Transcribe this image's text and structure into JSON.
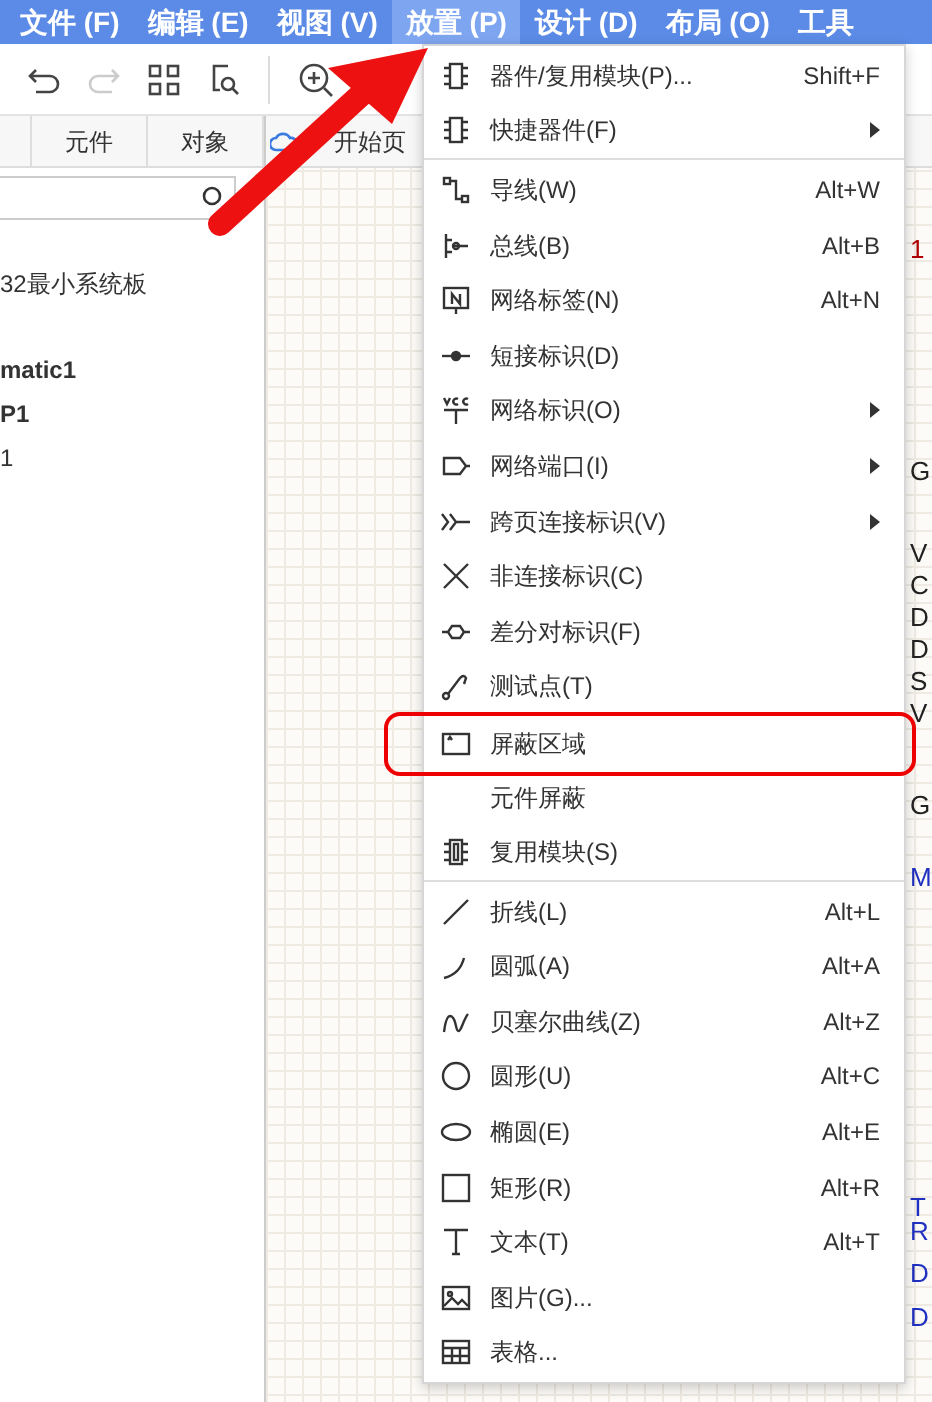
{
  "menu_bar": [
    {
      "label": "文件 (F)",
      "selected": false
    },
    {
      "label": "编辑 (E)",
      "selected": false
    },
    {
      "label": "视图 (V)",
      "selected": false
    },
    {
      "label": "放置 (P)",
      "selected": true
    },
    {
      "label": "设计 (D)",
      "selected": false
    },
    {
      "label": "布局 (O)",
      "selected": false
    },
    {
      "label": "工具",
      "selected": false
    }
  ],
  "panel_tabs": [
    {
      "label": "元件"
    },
    {
      "label": "对象"
    },
    {
      "label": "开始页"
    }
  ],
  "tree": [
    {
      "label": "32最小系统板",
      "bold": false
    },
    {
      "label": "matic1",
      "bold": true
    },
    {
      "label": "P1",
      "bold": true
    },
    {
      "label": "1",
      "bold": false
    }
  ],
  "canvas_labels": [
    {
      "text": "1",
      "color": "#b00000"
    },
    {
      "text": "G",
      "color": "#222222"
    },
    {
      "text": "V",
      "color": "#222222"
    },
    {
      "text": "C",
      "color": "#222222"
    },
    {
      "text": "D",
      "color": "#222222"
    },
    {
      "text": "D",
      "color": "#222222"
    },
    {
      "text": "S",
      "color": "#222222"
    },
    {
      "text": "V",
      "color": "#222222"
    },
    {
      "text": "G",
      "color": "#222222"
    },
    {
      "text": "M",
      "color": "#2030c0"
    },
    {
      "text": "T",
      "color": "#2030c0"
    },
    {
      "text": "R",
      "color": "#2030c0"
    },
    {
      "text": "D",
      "color": "#2030c0"
    },
    {
      "text": "D",
      "color": "#2030c0"
    }
  ],
  "place_menu": {
    "groups": [
      [
        {
          "kind": "chip",
          "label": "器件/复用模块(P)...",
          "shortcut": "Shift+F",
          "submenu": false,
          "circled": false
        },
        {
          "kind": "chip",
          "label": "快捷器件(F)",
          "submenu": true,
          "circled": false
        }
      ],
      [
        {
          "kind": "wire",
          "label": "导线(W)",
          "shortcut": "Alt+W",
          "submenu": false,
          "circled": false
        },
        {
          "kind": "bus",
          "label": "总线(B)",
          "shortcut": "Alt+B",
          "submenu": false,
          "circled": false
        },
        {
          "kind": "netlabel",
          "label": "网络标签(N)",
          "shortcut": "Alt+N",
          "submenu": false,
          "circled": false
        },
        {
          "kind": "short",
          "label": "短接标识(D)",
          "submenu": false,
          "circled": false
        },
        {
          "kind": "vcc",
          "label": "网络标识(O)",
          "submenu": true,
          "circled": false
        },
        {
          "kind": "port",
          "label": "网络端口(I)",
          "submenu": true,
          "circled": false
        },
        {
          "kind": "offpage",
          "label": "跨页连接标识(V)",
          "submenu": true,
          "circled": false
        },
        {
          "kind": "noconnect",
          "label": "非连接标识(C)",
          "submenu": false,
          "circled": false
        },
        {
          "kind": "diff",
          "label": "差分对标识(F)",
          "submenu": false,
          "circled": false
        },
        {
          "kind": "probe",
          "label": "测试点(T)",
          "submenu": false,
          "circled": false
        },
        {
          "kind": "area",
          "label": "屏蔽区域",
          "submenu": false,
          "circled": true
        },
        {
          "kind": "none",
          "label": "元件屏蔽",
          "submenu": false,
          "circled": false
        },
        {
          "kind": "module",
          "label": "复用模块(S)",
          "submenu": false,
          "circled": false
        }
      ],
      [
        {
          "kind": "line",
          "label": "折线(L)",
          "shortcut": "Alt+L",
          "submenu": false,
          "circled": false
        },
        {
          "kind": "arc",
          "label": "圆弧(A)",
          "shortcut": "Alt+A",
          "submenu": false,
          "circled": false
        },
        {
          "kind": "bezier",
          "label": "贝塞尔曲线(Z)",
          "shortcut": "Alt+Z",
          "submenu": false,
          "circled": false
        },
        {
          "kind": "circle",
          "label": "圆形(U)",
          "shortcut": "Alt+C",
          "submenu": false,
          "circled": false
        },
        {
          "kind": "ellipse",
          "label": "椭圆(E)",
          "shortcut": "Alt+E",
          "submenu": false,
          "circled": false
        },
        {
          "kind": "rect",
          "label": "矩形(R)",
          "shortcut": "Alt+R",
          "submenu": false,
          "circled": false
        },
        {
          "kind": "text",
          "label": "文本(T)",
          "shortcut": "Alt+T",
          "submenu": false,
          "circled": false
        },
        {
          "kind": "image",
          "label": "图片(G)...",
          "submenu": false,
          "circled": false
        },
        {
          "kind": "table",
          "label": "表格...",
          "submenu": false,
          "circled": false
        }
      ]
    ]
  }
}
